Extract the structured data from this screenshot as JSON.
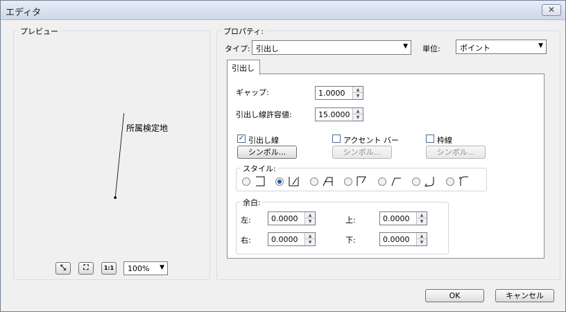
{
  "window": {
    "title": "エディタ",
    "close_glyph": "✕"
  },
  "preview": {
    "legend": "プレビュー",
    "label_text": "所属検定地",
    "zoom_value": "100%",
    "tools": [
      {
        "name": "zoom-in-icon",
        "glyph": "⤡"
      },
      {
        "name": "fit-icon",
        "glyph": "⛶"
      },
      {
        "name": "actual-size-icon",
        "glyph": "1:1"
      }
    ]
  },
  "properties": {
    "legend": "プロパティ:",
    "type_label": "タイプ:",
    "type_value": "引出し",
    "unit_label": "単位:",
    "unit_value": "ポイント",
    "tab_label": "引出し",
    "gap_label": "ギャップ:",
    "gap_value": "1.0000",
    "tolerance_label": "引出し線許容値:",
    "tolerance_value": "15.0000",
    "leader_check_label": "引出し線",
    "leader_checked": true,
    "accent_check_label": "アクセント バー",
    "accent_checked": false,
    "frame_check_label": "枠線",
    "frame_checked": false,
    "symbol_label": "シンボル...",
    "style_legend": "スタイル:",
    "style_selected_index": 1,
    "margin_legend": "余白:",
    "margin": {
      "left_label": "左:",
      "left_value": "0.0000",
      "top_label": "上:",
      "top_value": "0.0000",
      "right_label": "右:",
      "right_value": "0.0000",
      "bottom_label": "下:",
      "bottom_value": "0.0000"
    }
  },
  "footer": {
    "ok_label": "OK",
    "cancel_label": "キャンセル"
  }
}
